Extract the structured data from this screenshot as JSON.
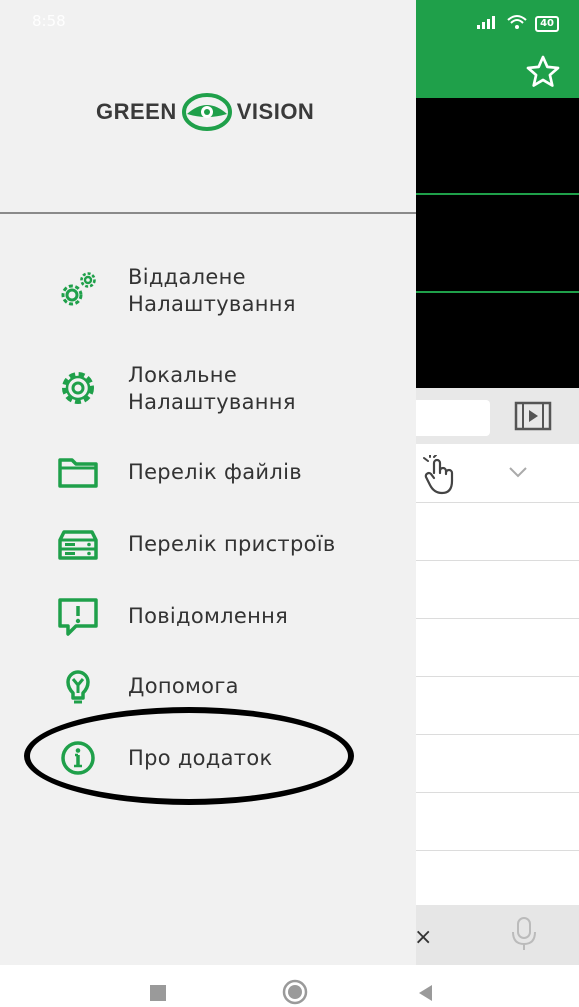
{
  "status_bar": {
    "time": "8:58",
    "battery": "40"
  },
  "brand": {
    "left": "GREEN",
    "right": "VISION",
    "accent": "#1fa04a"
  },
  "drawer": {
    "items": [
      {
        "label_line1": "Віддалене",
        "label_line2": "Налаштування",
        "icon": "remote-settings-gears-icon"
      },
      {
        "label_line1": "Локальне",
        "label_line2": "Налаштування",
        "icon": "gear-icon"
      },
      {
        "label": "Перелік файлів",
        "icon": "folder-icon"
      },
      {
        "label": "Перелік пристроїв",
        "icon": "device-dvr-icon"
      },
      {
        "label": "Повідомлення",
        "icon": "message-alert-icon"
      },
      {
        "label": "Допомога",
        "icon": "help-lightbulb-icon"
      },
      {
        "label": "Про додаток",
        "icon": "info-icon"
      }
    ]
  },
  "background_app": {
    "close_mark": "×"
  }
}
